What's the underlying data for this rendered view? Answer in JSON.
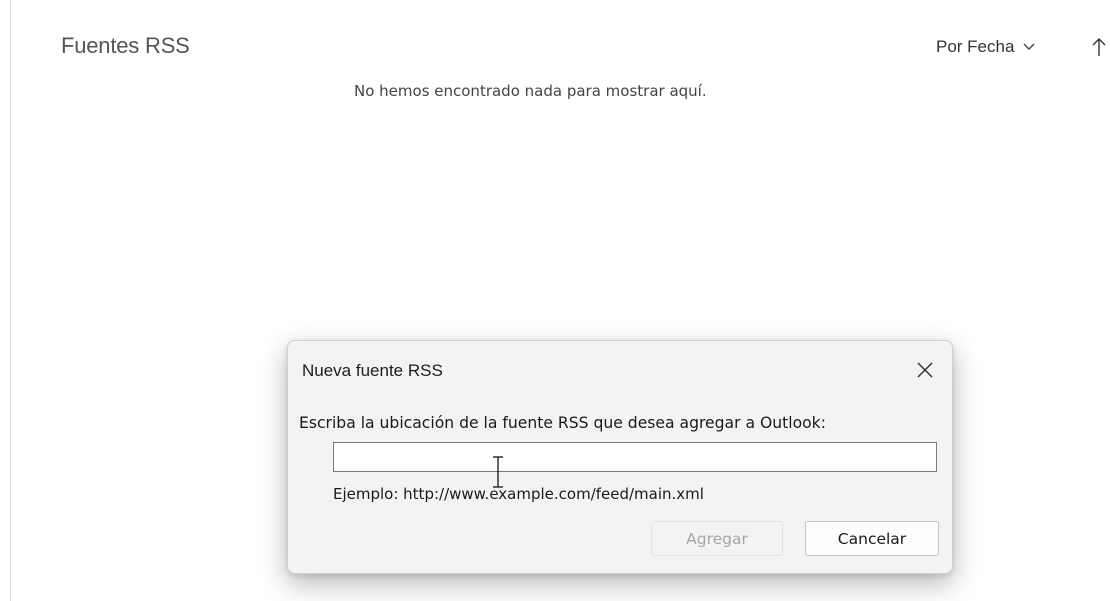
{
  "header": {
    "folder_title": "Fuentes RSS",
    "sort_label": "Por Fecha"
  },
  "main": {
    "empty_message": "No hemos encontrado nada para mostrar aquí."
  },
  "dialog": {
    "title": "Nueva fuente RSS",
    "prompt": "Escriba la ubicación de la fuente RSS que desea agregar a Outlook:",
    "input_value": "",
    "example": "Ejemplo: http://www.example.com/feed/main.xml",
    "add_label": "Agregar",
    "cancel_label": "Cancelar"
  },
  "icons": {
    "sort_dropdown": "chevron-down-icon",
    "sort_direction": "arrow-up-icon",
    "close": "close-icon",
    "text_cursor": "i-beam-cursor-icon"
  },
  "colors": {
    "dialog_background": "#f3f3f3",
    "disabled_text": "#a6a6a6"
  }
}
